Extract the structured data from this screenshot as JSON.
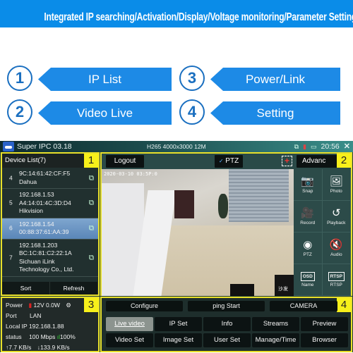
{
  "banner": {
    "title": "Integrated IP searching/Activation/Display/Voltage monitoring/Parameter Setting"
  },
  "features": [
    {
      "number": "1",
      "label": "IP List"
    },
    {
      "number": "2",
      "label": "Video Live"
    },
    {
      "number": "3",
      "label": "Power/Link"
    },
    {
      "number": "4",
      "label": "Setting"
    }
  ],
  "titlebar": {
    "app_title": "Super IPC 03.18",
    "resolution": "H265 4000x3000 12M",
    "time": "20:56",
    "close": "✕",
    "icons": [
      "network-icon",
      "sd-card-icon",
      "battery-icon"
    ]
  },
  "device_list": {
    "panel_tag": "1",
    "header": "Device List(7)",
    "items": [
      {
        "num": "4",
        "lines": [
          "9C:14:61:42:CF:F5",
          "Dahua"
        ],
        "selected": false
      },
      {
        "num": "5",
        "lines": [
          "192.168.1.53",
          "A4:14:01:4C:3D:D4",
          "Hikvision"
        ],
        "selected": false
      },
      {
        "num": "6",
        "lines": [
          "192.168.1.54",
          "00:88:37:61:AA:39"
        ],
        "selected": true
      },
      {
        "num": "7",
        "lines": [
          "192.168.1.203",
          "BC:1C:81:C2:22:1A",
          "Sichuan iLink",
          "Technology Co., Ltd."
        ],
        "selected": false
      }
    ],
    "sort_label": "Sort",
    "refresh_label": "Refresh"
  },
  "video_panel": {
    "panel_tag": "2",
    "logout_label": "Logout",
    "ptz_label": "PTZ",
    "ptz_checked": true,
    "advanced_label": "Advanc",
    "timestamp": "2020-03-10 03:5P:0",
    "overlay_label": "沙发",
    "controls": [
      {
        "label": "Snap",
        "icon": "camera-icon",
        "glyph": "📷"
      },
      {
        "label": "Photo",
        "icon": "photo-icon",
        "glyph": "🖼"
      },
      {
        "label": "Record",
        "icon": "video-camera-icon",
        "glyph": "🎥"
      },
      {
        "label": "Playback",
        "icon": "playback-icon",
        "glyph": "↺"
      },
      {
        "label": "PTZ",
        "icon": "ptz-camera-icon",
        "glyph": "◉"
      },
      {
        "label": "Audio",
        "icon": "audio-mute-icon",
        "glyph": "🔇"
      },
      {
        "label": "Name",
        "icon": "osd-icon",
        "box": "OSD"
      },
      {
        "label": "RTSP",
        "icon": "rtsp-icon",
        "box": "RTSP"
      }
    ]
  },
  "power_panel": {
    "panel_tag": "3",
    "power_label": "Power",
    "power_value": "12V 0.0W",
    "port_label": "Port",
    "port_value": "LAN",
    "local_ip_label": "Local IP",
    "local_ip_value": "192.168.1.88",
    "status_label": "status",
    "status_speed": "100 Mbps",
    "status_signal": "100%",
    "up_rate": "7.7 KB/s",
    "down_rate": "133.9 KB/s"
  },
  "settings_panel": {
    "panel_tag": "4",
    "top_buttons": [
      "Configure",
      "ping  Start",
      "CAMERA"
    ],
    "tabs_row1": [
      "Live video",
      "IP Set",
      "Info",
      "Streams",
      "Preview"
    ],
    "tabs_row2": [
      "Video Set",
      "Image Set",
      "User Set",
      "Manage/Time",
      "Browser"
    ],
    "active_tab": "Live video"
  },
  "colors": {
    "banner_blue": "#0a8ce8",
    "arrow_blue": "#1d8ae6",
    "panel_border_yellow": "#e9e02a",
    "tag_yellow": "#f7f01a",
    "selected_row": "#6a94c4"
  }
}
